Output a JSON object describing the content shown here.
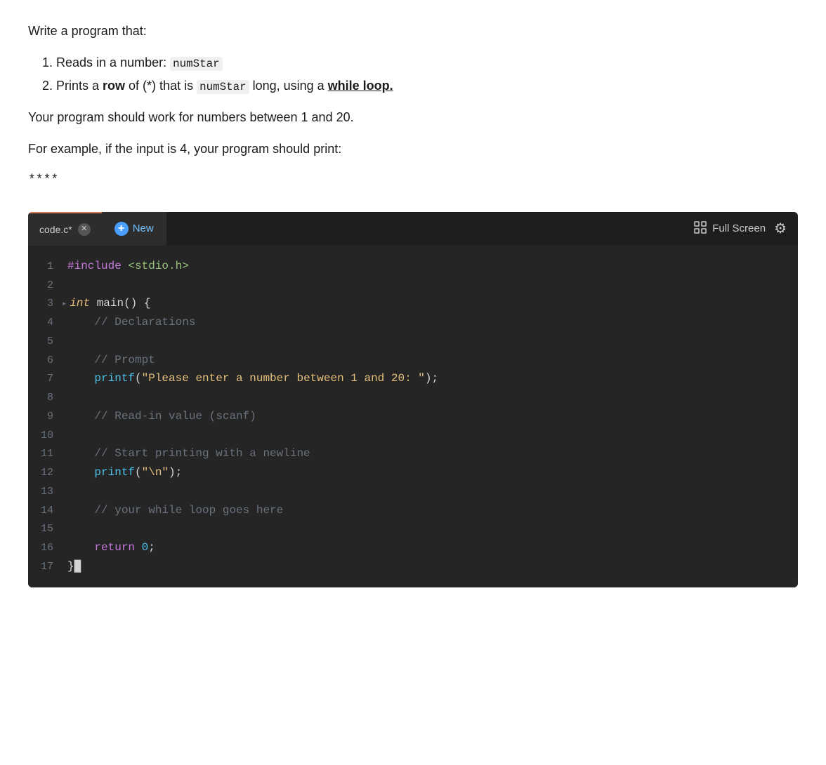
{
  "instructions": {
    "intro": "Write a program that:",
    "steps": [
      "Reads in a number: numStar",
      "Prints a row of (*) that is numStar long, using a while loop."
    ],
    "note": "Your program should work for numbers between 1 and 20.",
    "example": "For example, if the input is 4, your program should print:",
    "output": "****"
  },
  "editor": {
    "tab_active_label": "code.c*",
    "tab_new_label": "New",
    "fullscreen_label": "Full Screen",
    "lines": [
      {
        "num": "1",
        "content": "#include <stdio.h>"
      },
      {
        "num": "2",
        "content": ""
      },
      {
        "num": "3",
        "content": "int main() {",
        "has_arrow": true
      },
      {
        "num": "4",
        "content": "    // Declarations"
      },
      {
        "num": "5",
        "content": ""
      },
      {
        "num": "6",
        "content": "    // Prompt"
      },
      {
        "num": "7",
        "content": "    printf(\"Please enter a number between 1 and 20: \");"
      },
      {
        "num": "8",
        "content": ""
      },
      {
        "num": "9",
        "content": "    // Read-in value (scanf)"
      },
      {
        "num": "10",
        "content": ""
      },
      {
        "num": "11",
        "content": "    // Start printing with a newline"
      },
      {
        "num": "12",
        "content": "    printf(\"\\n\");"
      },
      {
        "num": "13",
        "content": ""
      },
      {
        "num": "14",
        "content": "    // your while loop goes here"
      },
      {
        "num": "15",
        "content": ""
      },
      {
        "num": "16",
        "content": "    return 0;"
      },
      {
        "num": "17",
        "content": "}"
      }
    ]
  }
}
